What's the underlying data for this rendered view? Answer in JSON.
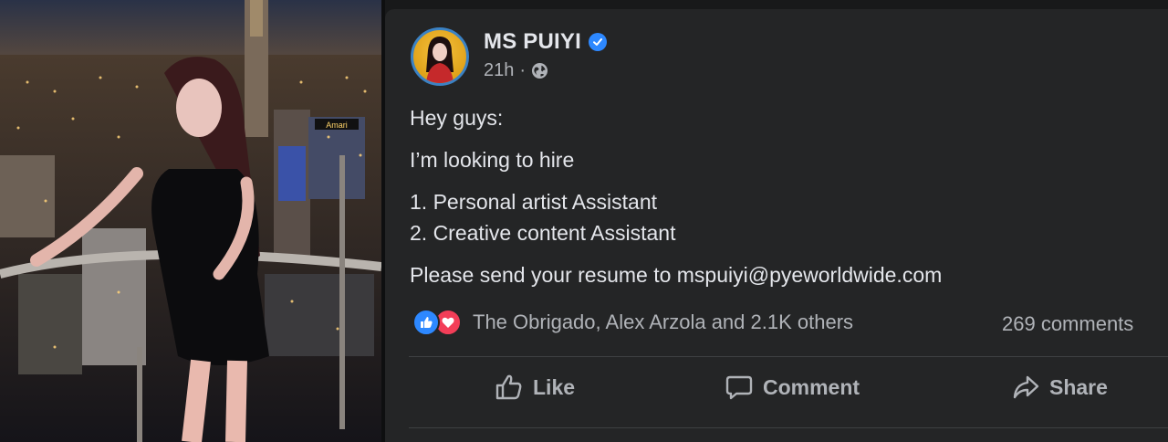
{
  "photo": {
    "sign_text": "Amari"
  },
  "post": {
    "author": "MS PUIYI",
    "time": "21h",
    "dot": "·",
    "lines": [
      "Hey guys:",
      "I’m looking to hire",
      "1. Personal artist Assistant",
      "2. Creative content Assistant",
      "Please send your resume to mspuiyi@pyeworldwide.com"
    ],
    "reactions_text": "The Obrigado, Alex Arzola and 2.1K others",
    "comments_text": "269 comments",
    "actions": {
      "like": "Like",
      "comment": "Comment",
      "share": "Share"
    }
  },
  "icons": {
    "verified": "verified-badge-icon",
    "privacy": "globe-icon",
    "like_reaction": "like-reaction-icon",
    "love_reaction": "love-reaction-icon",
    "like": "thumbs-up-icon",
    "comment": "comment-bubble-icon",
    "share": "share-arrow-icon"
  },
  "colors": {
    "background": "#18191a",
    "card": "#242526",
    "text_primary": "#e4e6eb",
    "text_secondary": "#b0b3b8",
    "accent_blue": "#2d88ff",
    "love_red": "#f33e58"
  }
}
